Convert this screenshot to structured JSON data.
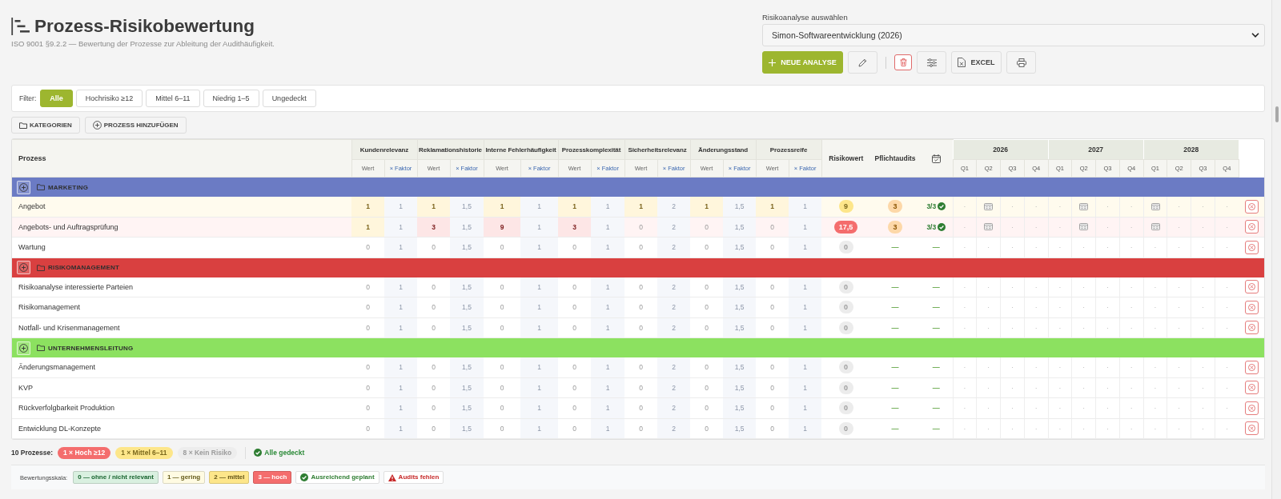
{
  "header": {
    "title": "Prozess-Risikobewertung",
    "subtitle": "ISO 9001 §9.2.2 — Bewertung der Prozesse zur Ableitung der Audithäufigkeit."
  },
  "analysis": {
    "label": "Risikoanalyse auswählen",
    "value": "Simon-Softwareentwicklung (2026)"
  },
  "toolbar": [
    {
      "kind": "add",
      "label": "NEUE ANALYSE"
    },
    {
      "kind": "edit"
    },
    {
      "kind": "delete"
    },
    {
      "kind": "settings"
    },
    {
      "kind": "excel",
      "label": "EXCEL"
    },
    {
      "kind": "print"
    }
  ],
  "filters": {
    "label": "Filter:",
    "options": [
      {
        "label": "Alle",
        "selected": true
      },
      {
        "label": "Hochrisiko ≥12",
        "selected": false
      },
      {
        "label": "Mittel 6–11",
        "selected": false
      },
      {
        "label": "Niedrig 1–5",
        "selected": false
      },
      {
        "label": "Ungedeckt",
        "selected": false
      }
    ]
  },
  "actions": [
    {
      "kind": "categories",
      "label": "KATEGORIEN"
    },
    {
      "kind": "add",
      "label": "PROZESS HINZUFÜGEN"
    }
  ],
  "table": {
    "process_header": "Prozess",
    "criteria": [
      {
        "name": "Kundenrelevanz",
        "value_label": "Wert",
        "factor_label": "× Faktor"
      },
      {
        "name": "Reklamationshistorie",
        "value_label": "Wert",
        "factor_label": "× Faktor"
      },
      {
        "name": "Interne Fehlerhäufigkeit",
        "value_label": "Wert",
        "factor_label": "× Faktor"
      },
      {
        "name": "Prozesskomplexität",
        "value_label": "Wert",
        "factor_label": "× Faktor"
      },
      {
        "name": "Sicherheitsrelevanz",
        "value_label": "Wert",
        "factor_label": "× Faktor"
      },
      {
        "name": "Änderungsstand",
        "value_label": "Wert",
        "factor_label": "× Faktor"
      },
      {
        "name": "Prozessreife",
        "value_label": "Wert",
        "factor_label": "× Faktor"
      }
    ],
    "risk_header": "Risikowert",
    "audits_header": "Pflichtaudits",
    "years": [
      {
        "label": "2026",
        "quarters": [
          "Q1",
          "Q2",
          "Q3",
          "Q4"
        ]
      },
      {
        "label": "2027",
        "quarters": [
          "Q1",
          "Q2",
          "Q3",
          "Q4"
        ]
      },
      {
        "label": "2028",
        "quarters": [
          "Q1",
          "Q2",
          "Q3",
          "Q4"
        ]
      }
    ],
    "groups": [
      {
        "name": "MARKETING",
        "color": "#6b7bc4",
        "rows": [
          {
            "name": "Angebot",
            "color": "#fffbee",
            "cells": [
              {
                "value": "1",
                "factor": "1",
                "color": "#fff6dc"
              },
              {
                "value": "1",
                "factor": "1,5",
                "color": "#fff6dc"
              },
              {
                "value": "1",
                "factor": "1",
                "color": "#fff6dc"
              },
              {
                "value": "1",
                "factor": "1",
                "color": "#fff6dc"
              },
              {
                "value": "1",
                "factor": "2",
                "color": "#fff6dc"
              },
              {
                "value": "1",
                "factor": "1,5",
                "color": "#fff6dc"
              },
              {
                "value": "1",
                "factor": "1",
                "color": "#fff6dc"
              }
            ],
            "risk": {
              "text": "9",
              "color": "#fde68a"
            },
            "audits": {
              "text": "3",
              "badge": true
            },
            "coverage": {
              "text": "3/3",
              "check": true
            },
            "quarters": [
              {
                "planned": false,
                "text": "·"
              },
              {
                "planned": true
              },
              {
                "planned": false,
                "text": "·"
              },
              {
                "planned": false,
                "text": "·"
              },
              {
                "planned": false,
                "text": "·"
              },
              {
                "planned": true
              },
              {
                "planned": false,
                "text": "·"
              },
              {
                "planned": false,
                "text": "·"
              },
              {
                "planned": true
              },
              {
                "planned": false,
                "text": "·"
              },
              {
                "planned": false,
                "text": "·"
              },
              {
                "planned": false,
                "text": "·"
              }
            ]
          },
          {
            "name": "Angebots- und Auftragsprüfung",
            "color": "#fff4f4",
            "cells": [
              {
                "value": "1",
                "factor": "1",
                "color": "#fff6dc"
              },
              {
                "value": "3",
                "factor": "1,5",
                "color": "#fde6e6"
              },
              {
                "value": "9",
                "factor": "1",
                "color": "#fde6e6"
              },
              {
                "value": "3",
                "factor": "1",
                "color": "#fde6e6"
              },
              {
                "value": "0",
                "factor": "2"
              },
              {
                "value": "0",
                "factor": "1,5"
              },
              {
                "value": "0",
                "factor": "1"
              }
            ],
            "risk": {
              "text": "17,5",
              "color": "#f46d6d"
            },
            "audits": {
              "text": "3",
              "badge": true
            },
            "coverage": {
              "text": "3/3",
              "check": true
            },
            "quarters": [
              {
                "planned": false,
                "text": "·"
              },
              {
                "planned": true
              },
              {
                "planned": false,
                "text": "·"
              },
              {
                "planned": false,
                "text": "·"
              },
              {
                "planned": false,
                "text": "·"
              },
              {
                "planned": true
              },
              {
                "planned": false,
                "text": "·"
              },
              {
                "planned": false,
                "text": "·"
              },
              {
                "planned": true
              },
              {
                "planned": false,
                "text": "·"
              },
              {
                "planned": false,
                "text": "·"
              },
              {
                "planned": false,
                "text": "·"
              }
            ]
          },
          {
            "name": "Wartung",
            "color": "#ffffff",
            "cells": [
              {
                "value": "0",
                "factor": "1"
              },
              {
                "value": "0",
                "factor": "1,5"
              },
              {
                "value": "0",
                "factor": "1"
              },
              {
                "value": "0",
                "factor": "1"
              },
              {
                "value": "0",
                "factor": "2"
              },
              {
                "value": "0",
                "factor": "1,5"
              },
              {
                "value": "0",
                "factor": "1"
              }
            ],
            "risk": {
              "text": "0",
              "color": "#ececec"
            },
            "audits": {
              "text": "—",
              "badge": false
            },
            "coverage": {
              "text": "—",
              "check": false
            },
            "quarters": [
              {
                "planned": false,
                "text": "·"
              },
              {
                "planned": false,
                "text": "·"
              },
              {
                "planned": false,
                "text": "·"
              },
              {
                "planned": false,
                "text": "·"
              },
              {
                "planned": false,
                "text": "·"
              },
              {
                "planned": false,
                "text": "·"
              },
              {
                "planned": false,
                "text": "·"
              },
              {
                "planned": false,
                "text": "·"
              },
              {
                "planned": false,
                "text": "·"
              },
              {
                "planned": false,
                "text": "·"
              },
              {
                "planned": false,
                "text": "·"
              },
              {
                "planned": false,
                "text": "·"
              }
            ]
          }
        ]
      },
      {
        "name": "RISIKOMANAGEMENT",
        "color": "#d94040",
        "rows": [
          {
            "name": "Risikoanalyse interessierte Parteien",
            "color": "#ffffff",
            "cells": [
              {
                "value": "0",
                "factor": "1"
              },
              {
                "value": "0",
                "factor": "1,5"
              },
              {
                "value": "0",
                "factor": "1"
              },
              {
                "value": "0",
                "factor": "1"
              },
              {
                "value": "0",
                "factor": "2"
              },
              {
                "value": "0",
                "factor": "1,5"
              },
              {
                "value": "0",
                "factor": "1"
              }
            ],
            "risk": {
              "text": "0",
              "color": "#ececec"
            },
            "audits": {
              "text": "—",
              "badge": false
            },
            "coverage": {
              "text": "—",
              "check": false
            },
            "quarters": [
              {
                "planned": false,
                "text": "·"
              },
              {
                "planned": false,
                "text": "·"
              },
              {
                "planned": false,
                "text": "·"
              },
              {
                "planned": false,
                "text": "·"
              },
              {
                "planned": false,
                "text": "·"
              },
              {
                "planned": false,
                "text": "·"
              },
              {
                "planned": false,
                "text": "·"
              },
              {
                "planned": false,
                "text": "·"
              },
              {
                "planned": false,
                "text": "·"
              },
              {
                "planned": false,
                "text": "·"
              },
              {
                "planned": false,
                "text": "·"
              },
              {
                "planned": false,
                "text": "·"
              }
            ]
          },
          {
            "name": "Risikomanagement",
            "color": "#ffffff",
            "cells": [
              {
                "value": "0",
                "factor": "1"
              },
              {
                "value": "0",
                "factor": "1,5"
              },
              {
                "value": "0",
                "factor": "1"
              },
              {
                "value": "0",
                "factor": "1"
              },
              {
                "value": "0",
                "factor": "2"
              },
              {
                "value": "0",
                "factor": "1,5"
              },
              {
                "value": "0",
                "factor": "1"
              }
            ],
            "risk": {
              "text": "0",
              "color": "#ececec"
            },
            "audits": {
              "text": "—",
              "badge": false
            },
            "coverage": {
              "text": "—",
              "check": false
            },
            "quarters": [
              {
                "planned": false,
                "text": "·"
              },
              {
                "planned": false,
                "text": "·"
              },
              {
                "planned": false,
                "text": "·"
              },
              {
                "planned": false,
                "text": "·"
              },
              {
                "planned": false,
                "text": "·"
              },
              {
                "planned": false,
                "text": "·"
              },
              {
                "planned": false,
                "text": "·"
              },
              {
                "planned": false,
                "text": "·"
              },
              {
                "planned": false,
                "text": "·"
              },
              {
                "planned": false,
                "text": "·"
              },
              {
                "planned": false,
                "text": "·"
              },
              {
                "planned": false,
                "text": "·"
              }
            ]
          },
          {
            "name": "Notfall- und Krisenmanagement",
            "color": "#ffffff",
            "cells": [
              {
                "value": "0",
                "factor": "1"
              },
              {
                "value": "0",
                "factor": "1,5"
              },
              {
                "value": "0",
                "factor": "1"
              },
              {
                "value": "0",
                "factor": "1"
              },
              {
                "value": "0",
                "factor": "2"
              },
              {
                "value": "0",
                "factor": "1,5"
              },
              {
                "value": "0",
                "factor": "1"
              }
            ],
            "risk": {
              "text": "0",
              "color": "#ececec"
            },
            "audits": {
              "text": "—",
              "badge": false
            },
            "coverage": {
              "text": "—",
              "check": false
            },
            "quarters": [
              {
                "planned": false,
                "text": "·"
              },
              {
                "planned": false,
                "text": "·"
              },
              {
                "planned": false,
                "text": "·"
              },
              {
                "planned": false,
                "text": "·"
              },
              {
                "planned": false,
                "text": "·"
              },
              {
                "planned": false,
                "text": "·"
              },
              {
                "planned": false,
                "text": "·"
              },
              {
                "planned": false,
                "text": "·"
              },
              {
                "planned": false,
                "text": "·"
              },
              {
                "planned": false,
                "text": "·"
              },
              {
                "planned": false,
                "text": "·"
              },
              {
                "planned": false,
                "text": "·"
              }
            ]
          }
        ]
      },
      {
        "name": "UNTERNEHMENSLEITUNG",
        "color": "#8ce160",
        "rows": [
          {
            "name": "Änderungsmanagement",
            "color": "#ffffff",
            "cells": [
              {
                "value": "0",
                "factor": "1"
              },
              {
                "value": "0",
                "factor": "1,5"
              },
              {
                "value": "0",
                "factor": "1"
              },
              {
                "value": "0",
                "factor": "1"
              },
              {
                "value": "0",
                "factor": "2"
              },
              {
                "value": "0",
                "factor": "1,5"
              },
              {
                "value": "0",
                "factor": "1"
              }
            ],
            "risk": {
              "text": "0",
              "color": "#ececec"
            },
            "audits": {
              "text": "—",
              "badge": false
            },
            "coverage": {
              "text": "—",
              "check": false
            },
            "quarters": [
              {
                "planned": false,
                "text": "·"
              },
              {
                "planned": false,
                "text": "·"
              },
              {
                "planned": false,
                "text": "·"
              },
              {
                "planned": false,
                "text": "·"
              },
              {
                "planned": false,
                "text": "·"
              },
              {
                "planned": false,
                "text": "·"
              },
              {
                "planned": false,
                "text": "·"
              },
              {
                "planned": false,
                "text": "·"
              },
              {
                "planned": false,
                "text": "·"
              },
              {
                "planned": false,
                "text": "·"
              },
              {
                "planned": false,
                "text": "·"
              },
              {
                "planned": false,
                "text": "·"
              }
            ]
          },
          {
            "name": "KVP",
            "color": "#ffffff",
            "cells": [
              {
                "value": "0",
                "factor": "1"
              },
              {
                "value": "0",
                "factor": "1,5"
              },
              {
                "value": "0",
                "factor": "1"
              },
              {
                "value": "0",
                "factor": "1"
              },
              {
                "value": "0",
                "factor": "2"
              },
              {
                "value": "0",
                "factor": "1,5"
              },
              {
                "value": "0",
                "factor": "1"
              }
            ],
            "risk": {
              "text": "0",
              "color": "#ececec"
            },
            "audits": {
              "text": "—",
              "badge": false
            },
            "coverage": {
              "text": "—",
              "check": false
            },
            "quarters": [
              {
                "planned": false,
                "text": "·"
              },
              {
                "planned": false,
                "text": "·"
              },
              {
                "planned": false,
                "text": "·"
              },
              {
                "planned": false,
                "text": "·"
              },
              {
                "planned": false,
                "text": "·"
              },
              {
                "planned": false,
                "text": "·"
              },
              {
                "planned": false,
                "text": "·"
              },
              {
                "planned": false,
                "text": "·"
              },
              {
                "planned": false,
                "text": "·"
              },
              {
                "planned": false,
                "text": "·"
              },
              {
                "planned": false,
                "text": "·"
              },
              {
                "planned": false,
                "text": "·"
              }
            ]
          },
          {
            "name": "Rückverfolgbarkeit Produktion",
            "color": "#ffffff",
            "cells": [
              {
                "value": "0",
                "factor": "1"
              },
              {
                "value": "0",
                "factor": "1,5"
              },
              {
                "value": "0",
                "factor": "1"
              },
              {
                "value": "0",
                "factor": "1"
              },
              {
                "value": "0",
                "factor": "2"
              },
              {
                "value": "0",
                "factor": "1,5"
              },
              {
                "value": "0",
                "factor": "1"
              }
            ],
            "risk": {
              "text": "0",
              "color": "#ececec"
            },
            "audits": {
              "text": "—",
              "badge": false
            },
            "coverage": {
              "text": "—",
              "check": false
            },
            "quarters": [
              {
                "planned": false,
                "text": "·"
              },
              {
                "planned": false,
                "text": "·"
              },
              {
                "planned": false,
                "text": "·"
              },
              {
                "planned": false,
                "text": "·"
              },
              {
                "planned": false,
                "text": "·"
              },
              {
                "planned": false,
                "text": "·"
              },
              {
                "planned": false,
                "text": "·"
              },
              {
                "planned": false,
                "text": "·"
              },
              {
                "planned": false,
                "text": "·"
              },
              {
                "planned": false,
                "text": "·"
              },
              {
                "planned": false,
                "text": "·"
              },
              {
                "planned": false,
                "text": "·"
              }
            ]
          },
          {
            "name": "Entwicklung DL-Konzepte",
            "color": "#ffffff",
            "cells": [
              {
                "value": "0",
                "factor": "1"
              },
              {
                "value": "0",
                "factor": "1,5"
              },
              {
                "value": "0",
                "factor": "1"
              },
              {
                "value": "0",
                "factor": "1"
              },
              {
                "value": "0",
                "factor": "2"
              },
              {
                "value": "0",
                "factor": "1,5"
              },
              {
                "value": "0",
                "factor": "1"
              }
            ],
            "risk": {
              "text": "0",
              "color": "#ececec"
            },
            "audits": {
              "text": "—",
              "badge": false
            },
            "coverage": {
              "text": "—",
              "check": false
            },
            "quarters": [
              {
                "planned": false,
                "text": "·"
              },
              {
                "planned": false,
                "text": "·"
              },
              {
                "planned": false,
                "text": "·"
              },
              {
                "planned": false,
                "text": "·"
              },
              {
                "planned": false,
                "text": "·"
              },
              {
                "planned": false,
                "text": "·"
              },
              {
                "planned": false,
                "text": "·"
              },
              {
                "planned": false,
                "text": "·"
              },
              {
                "planned": false,
                "text": "·"
              },
              {
                "planned": false,
                "text": "·"
              },
              {
                "planned": false,
                "text": "·"
              },
              {
                "planned": false,
                "text": "·"
              }
            ]
          }
        ]
      }
    ]
  },
  "summary": {
    "label": "10 Prozesse:",
    "counts": [
      {
        "text": "1 × Hoch ≥12",
        "color": "#f46d6d"
      },
      {
        "text": "1 × Mittel 6–11",
        "color": "#fde68a"
      },
      {
        "text": "8 × Kein Risiko",
        "color": "#ededed"
      }
    ],
    "coverage": {
      "text": "Alle gedeckt",
      "check": true
    }
  },
  "legend": {
    "label": "Bewertungsskala:",
    "items": [
      {
        "kind": "scale",
        "color": "#d9f0e0",
        "text": "0 — ohne / nicht relevant"
      },
      {
        "kind": "scale",
        "color": "#fffbe2",
        "text": "1 — gering"
      },
      {
        "kind": "scale",
        "color": "#fde68a",
        "text": "2 — mittel"
      },
      {
        "kind": "scale",
        "color": "#f46d6d",
        "text": "3 — hoch"
      },
      {
        "kind": "ok",
        "text": "Ausreichend geplant"
      },
      {
        "kind": "missing",
        "text": "Audits fehlen"
      }
    ]
  }
}
